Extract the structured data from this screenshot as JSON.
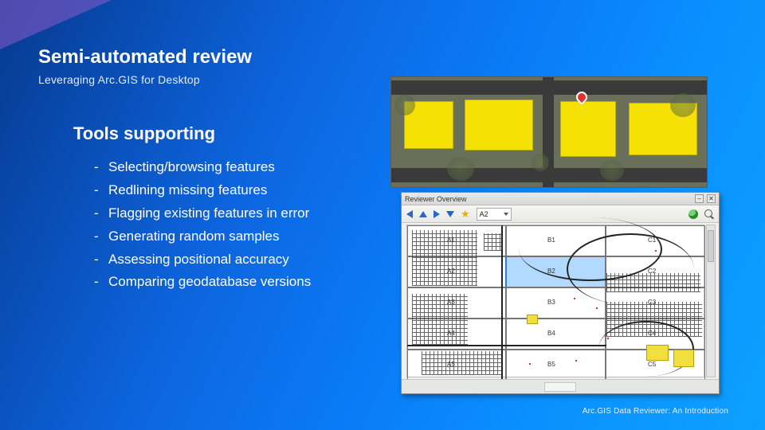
{
  "title": "Semi-automated review",
  "subtitle": "Leveraging Arc.GIS for Desktop",
  "section_heading": "Tools supporting",
  "bullets": [
    "Selecting/browsing features",
    "Redlining missing features",
    "Flagging existing features in error",
    "Generating random samples",
    "Assessing positional accuracy",
    "Comparing geodatabase versions"
  ],
  "footer": "Arc.GIS Data Reviewer: An Introduction",
  "reviewer": {
    "window_title": "Reviewer Overview",
    "combo_value": "A2",
    "close_glyph": "✕",
    "min_glyph": "–",
    "cells": [
      {
        "id": "A1"
      },
      {
        "id": "B1"
      },
      {
        "id": "C1"
      },
      {
        "id": "A2"
      },
      {
        "id": "B2"
      },
      {
        "id": "C2"
      },
      {
        "id": "A3"
      },
      {
        "id": "B3"
      },
      {
        "id": "C3"
      },
      {
        "id": "A4"
      },
      {
        "id": "B4"
      },
      {
        "id": "C4"
      },
      {
        "id": "A5"
      },
      {
        "id": "B5"
      },
      {
        "id": "C5"
      }
    ]
  },
  "icons": {
    "star": "★"
  }
}
